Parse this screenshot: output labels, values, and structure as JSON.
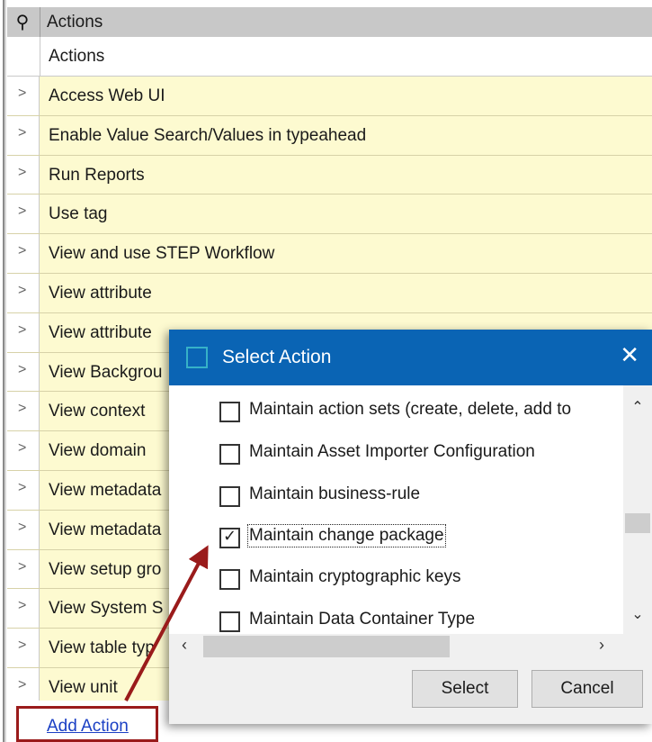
{
  "panel": {
    "header_title": "Actions",
    "column_header": "Actions",
    "rows": [
      {
        "label": "Access Web UI"
      },
      {
        "label": "Enable Value Search/Values in typeahead"
      },
      {
        "label": "Run Reports"
      },
      {
        "label": "Use tag"
      },
      {
        "label": "View and use STEP Workflow"
      },
      {
        "label": "View attribute"
      },
      {
        "label": "View attribute"
      },
      {
        "label": "View Backgrou"
      },
      {
        "label": "View context"
      },
      {
        "label": "View domain"
      },
      {
        "label": "View metadata"
      },
      {
        "label": "View metadata"
      },
      {
        "label": "View setup gro"
      },
      {
        "label": "View System S"
      },
      {
        "label": "View table typ"
      },
      {
        "label": "View unit"
      }
    ],
    "add_action_label": "Add Action"
  },
  "dialog": {
    "title": "Select Action",
    "close_glyph": "✕",
    "items": [
      {
        "label": "Maintain action sets (create, delete, add to",
        "checked": false
      },
      {
        "label": "Maintain Asset Importer Configuration",
        "checked": false
      },
      {
        "label": "Maintain business-rule",
        "checked": false
      },
      {
        "label": "Maintain change package",
        "checked": true
      },
      {
        "label": "Maintain cryptographic keys",
        "checked": false
      },
      {
        "label": "Maintain Data Container Type",
        "checked": false
      }
    ],
    "select_label": "Select",
    "cancel_label": "Cancel"
  },
  "colors": {
    "row_background": "#fdfad0",
    "title_bar": "#0a64b4",
    "annotation": "#9a1b1b",
    "link": "#1a3fc4"
  },
  "icons": {
    "pin": "pin-icon",
    "chevron": "chevron-right-icon",
    "close": "close-icon"
  }
}
